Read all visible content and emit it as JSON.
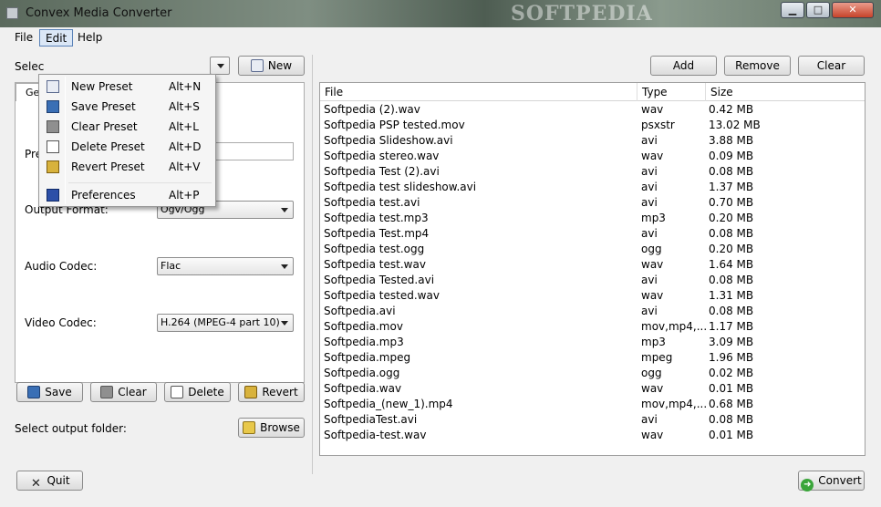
{
  "window": {
    "title": "Convex Media Converter",
    "watermark": "SOFTPEDIA",
    "controls": {
      "minimize": "▁",
      "maximize": "□",
      "close": "✕"
    }
  },
  "menubar": {
    "file": "File",
    "edit": "Edit",
    "help": "Help"
  },
  "edit_menu": {
    "items": [
      {
        "label": "New Preset",
        "shortcut": "Alt+N",
        "icon": "new-preset-icon"
      },
      {
        "label": "Save Preset",
        "shortcut": "Alt+S",
        "icon": "save-icon"
      },
      {
        "label": "Clear Preset",
        "shortcut": "Alt+L",
        "icon": "trash-icon"
      },
      {
        "label": "Delete Preset",
        "shortcut": "Alt+D",
        "icon": "delete-icon"
      },
      {
        "label": "Revert Preset",
        "shortcut": "Alt+V",
        "icon": "broom-icon"
      },
      {
        "label": "Preferences",
        "shortcut": "Alt+P",
        "icon": "preferences-icon"
      }
    ]
  },
  "left": {
    "select_label": "Selec",
    "new_button": "New",
    "tab_label": "Ge",
    "preset_label": "Pre",
    "output_format_label": "Output Format:",
    "output_format_value": "Ogv/Ogg",
    "audio_codec_label": "Audio Codec:",
    "audio_codec_value": "Flac",
    "video_codec_label": "Video Codec:",
    "video_codec_value": "H.264 (MPEG-4 part 10)",
    "buttons": {
      "save": "Save",
      "clear": "Clear",
      "delete": "Delete",
      "revert": "Revert"
    },
    "output_folder_label": "Select output folder:",
    "browse_button": "Browse"
  },
  "right": {
    "buttons": {
      "add": "Add",
      "remove": "Remove",
      "clear": "Clear"
    },
    "columns": [
      "File",
      "Type",
      "Size"
    ],
    "files": [
      {
        "file": "Softpedia (2).wav",
        "type": "wav",
        "size": "0.42 MB"
      },
      {
        "file": "Softpedia PSP tested.mov",
        "type": "psxstr",
        "size": "13.02 MB"
      },
      {
        "file": "Softpedia Slideshow.avi",
        "type": "avi",
        "size": "3.88 MB"
      },
      {
        "file": "Softpedia stereo.wav",
        "type": "wav",
        "size": "0.09 MB"
      },
      {
        "file": "Softpedia Test (2).avi",
        "type": "avi",
        "size": "0.08 MB"
      },
      {
        "file": "Softpedia test slideshow.avi",
        "type": "avi",
        "size": "1.37 MB"
      },
      {
        "file": "Softpedia test.avi",
        "type": "avi",
        "size": "0.70 MB"
      },
      {
        "file": "Softpedia test.mp3",
        "type": "mp3",
        "size": "0.20 MB"
      },
      {
        "file": "Softpedia Test.mp4",
        "type": "avi",
        "size": "0.08 MB"
      },
      {
        "file": "Softpedia test.ogg",
        "type": "ogg",
        "size": "0.20 MB"
      },
      {
        "file": "Softpedia test.wav",
        "type": "wav",
        "size": "1.64 MB"
      },
      {
        "file": "Softpedia Tested.avi",
        "type": "avi",
        "size": "0.08 MB"
      },
      {
        "file": "Softpedia tested.wav",
        "type": "wav",
        "size": "1.31 MB"
      },
      {
        "file": "Softpedia.avi",
        "type": "avi",
        "size": "0.08 MB"
      },
      {
        "file": "Softpedia.mov",
        "type": "mov,mp4,...",
        "size": "1.17 MB"
      },
      {
        "file": "Softpedia.mp3",
        "type": "mp3",
        "size": "3.09 MB"
      },
      {
        "file": "Softpedia.mpeg",
        "type": "mpeg",
        "size": "1.96 MB"
      },
      {
        "file": "Softpedia.ogg",
        "type": "ogg",
        "size": "0.02 MB"
      },
      {
        "file": "Softpedia.wav",
        "type": "wav",
        "size": "0.01 MB"
      },
      {
        "file": "Softpedia_(new_1).mp4",
        "type": "mov,mp4,...",
        "size": "0.68 MB"
      },
      {
        "file": "SoftpediaTest.avi",
        "type": "avi",
        "size": "0.08 MB"
      },
      {
        "file": "Softpedia-test.wav",
        "type": "wav",
        "size": "0.01 MB"
      }
    ]
  },
  "footer": {
    "quit": "Quit",
    "convert": "Convert"
  }
}
